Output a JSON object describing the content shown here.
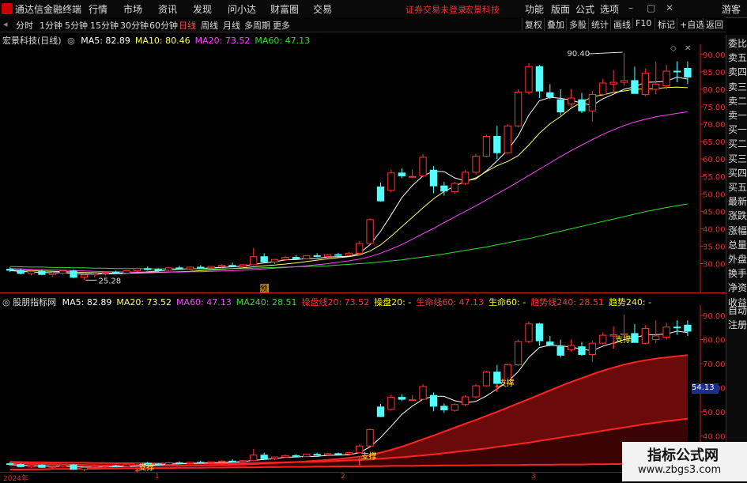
{
  "app": {
    "title": "通达信金融终端"
  },
  "menu": [
    "行情",
    "市场",
    "资讯",
    "发现",
    "问小达",
    "财富圈",
    "交易"
  ],
  "warning": "证券交易未登录",
  "brand": "宏景科技",
  "right_menu": [
    "功能",
    "版面",
    "公式",
    "选项"
  ],
  "window_controls": [
    "–",
    "▢",
    "✕"
  ],
  "guest": "游客",
  "periods": [
    "分时",
    "1分钟",
    "5分钟",
    "15分钟",
    "30分钟",
    "60分钟",
    "日线",
    "周线",
    "月线",
    "多周期",
    "更多"
  ],
  "active_period": "日线",
  "tools": [
    "复权",
    "叠加",
    "多股",
    "统计",
    "画线",
    "F10",
    "标记",
    "+自选",
    "返回"
  ],
  "main_chart": {
    "stock": "宏景科技(日线)",
    "legend": [
      {
        "label": "MA5: 82.89",
        "color": "#ffffff"
      },
      {
        "label": "MA10: 80.46",
        "color": "#ffff66"
      },
      {
        "label": "MA20: 73.52",
        "color": "#ff44ff"
      },
      {
        "label": "MA60: 47.13",
        "color": "#33dd33"
      }
    ],
    "y_ticks": [
      "90.00",
      "85.00",
      "80.00",
      "75.00",
      "70.00",
      "65.00",
      "60.00",
      "55.00",
      "50.00",
      "45.00",
      "40.00",
      "35.00",
      "30.00"
    ],
    "high_marker": "90.40",
    "low_marker": "25.28",
    "badge": "预"
  },
  "sub_chart": {
    "name": "股朋指标网",
    "legend": [
      {
        "label": "MA5: 82.89",
        "color": "#ffffff"
      },
      {
        "label": "MA20: 73.52",
        "color": "#ffff66"
      },
      {
        "label": "MA60: 47.13",
        "color": "#ff44ff"
      },
      {
        "label": "MA240: 28.51",
        "color": "#33dd33"
      },
      {
        "label": "操盘线20: 73.52",
        "color": "#ff3333"
      },
      {
        "label": "操盘20: -",
        "color": "#ffff00"
      },
      {
        "label": "生命线60: 47.13",
        "color": "#ff3333"
      },
      {
        "label": "生命60: -",
        "color": "#ffff00"
      },
      {
        "label": "趋势线240: 28.51",
        "color": "#ff3333"
      },
      {
        "label": "趋势240: -",
        "color": "#ffff00"
      }
    ],
    "y_ticks": [
      "90.00",
      "80.00",
      "70.00",
      "60.00",
      "50.00",
      "40.00"
    ],
    "value_tag": "54.13",
    "support_labels": [
      "支撑",
      "支撑",
      "支撑",
      "支撑"
    ]
  },
  "sidebar_top": [
    "委比",
    "卖五",
    "卖四",
    "卖三",
    "卖二",
    "卖一",
    "买一",
    "买二",
    "买三",
    "买四",
    "买五",
    "最新",
    "涨跌",
    "涨幅",
    "总量",
    "外盘",
    "换手",
    "净资",
    "收益"
  ],
  "sidebar_bottom": [
    "自动",
    "注册"
  ],
  "dates": [
    "2024年",
    "1",
    "2",
    "3"
  ],
  "watermark": {
    "title": "指标公式网",
    "url": "www.zbgs3.com"
  },
  "colors": {
    "up": "#ff3333",
    "down": "#54ffff",
    "axis": "#d33333"
  },
  "chart_data": {
    "type": "candlestick",
    "title": "宏景科技(日线)",
    "ylim": [
      24,
      92
    ],
    "x": [
      0,
      1,
      2,
      3,
      4,
      5,
      6,
      7,
      8,
      9,
      10,
      11,
      12,
      13,
      14,
      15,
      16,
      17,
      18,
      19,
      20,
      21,
      22,
      23,
      24,
      25,
      26,
      27,
      28,
      29,
      30,
      31,
      32,
      33,
      34,
      35,
      36,
      37,
      38,
      39,
      40,
      41,
      42,
      43,
      44,
      45,
      46,
      47,
      48,
      49,
      50,
      51,
      52,
      53,
      54,
      55,
      56,
      57,
      58,
      59,
      60,
      61,
      62,
      63,
      64
    ],
    "ohlc": [
      [
        28.4,
        29.0,
        27.6,
        28.1
      ],
      [
        28.1,
        28.6,
        26.9,
        27.2
      ],
      [
        27.2,
        28.0,
        26.6,
        27.8
      ],
      [
        27.8,
        28.2,
        26.7,
        26.9
      ],
      [
        26.9,
        27.5,
        26.2,
        27.3
      ],
      [
        27.3,
        28.1,
        26.8,
        27.9
      ],
      [
        27.9,
        28.3,
        25.8,
        26.1
      ],
      [
        26.1,
        27.0,
        25.3,
        26.8
      ],
      [
        26.8,
        27.4,
        26.0,
        27.2
      ],
      [
        27.2,
        27.9,
        26.6,
        27.5
      ],
      [
        27.5,
        28.0,
        27.0,
        27.3
      ],
      [
        27.3,
        28.2,
        27.1,
        28.0
      ],
      [
        28.0,
        28.9,
        27.6,
        28.6
      ],
      [
        28.6,
        29.2,
        28.0,
        28.3
      ],
      [
        28.3,
        28.7,
        27.6,
        28.1
      ],
      [
        28.1,
        29.0,
        27.8,
        28.8
      ],
      [
        28.8,
        29.4,
        28.3,
        28.5
      ],
      [
        28.5,
        29.2,
        28.1,
        29.0
      ],
      [
        29.0,
        29.6,
        28.5,
        28.8
      ],
      [
        28.8,
        29.3,
        28.4,
        29.2
      ],
      [
        29.2,
        29.8,
        28.9,
        29.5
      ],
      [
        29.5,
        30.3,
        29.0,
        29.3
      ],
      [
        29.3,
        29.9,
        29.0,
        29.7
      ],
      [
        29.7,
        34.5,
        29.5,
        32.0
      ],
      [
        32.0,
        33.0,
        30.2,
        30.5
      ],
      [
        30.5,
        31.4,
        29.9,
        31.2
      ],
      [
        31.2,
        32.2,
        30.8,
        31.8
      ],
      [
        31.8,
        32.4,
        31.0,
        31.4
      ],
      [
        31.4,
        32.5,
        31.2,
        32.3
      ],
      [
        32.3,
        33.0,
        31.8,
        32.1
      ],
      [
        32.1,
        32.8,
        31.6,
        32.6
      ],
      [
        32.6,
        33.1,
        32.0,
        32.4
      ],
      [
        32.4,
        33.3,
        32.2,
        33.0
      ],
      [
        33.0,
        36.5,
        32.8,
        35.8
      ],
      [
        35.8,
        43.0,
        35.5,
        42.6
      ],
      [
        52.0,
        53.2,
        47.8,
        48.0
      ],
      [
        51.0,
        57.0,
        50.5,
        56.0
      ],
      [
        56.0,
        57.3,
        54.5,
        55.2
      ],
      [
        55.0,
        57.0,
        54.6,
        55.0
      ],
      [
        55.2,
        61.5,
        54.8,
        60.5
      ],
      [
        56.8,
        58.0,
        50.2,
        52.3
      ],
      [
        52.3,
        53.5,
        49.5,
        50.8
      ],
      [
        50.6,
        53.5,
        50.0,
        53.0
      ],
      [
        53.0,
        56.8,
        52.5,
        56.2
      ],
      [
        56.2,
        61.5,
        55.5,
        60.8
      ],
      [
        60.8,
        67.0,
        60.5,
        66.5
      ],
      [
        66.5,
        69.5,
        60.0,
        61.8
      ],
      [
        61.8,
        70.0,
        61.5,
        69.5
      ],
      [
        69.5,
        80.0,
        69.0,
        79.2
      ],
      [
        79.2,
        87.5,
        78.5,
        86.5
      ],
      [
        86.5,
        87.0,
        77.5,
        79.5
      ],
      [
        79.0,
        81.5,
        77.2,
        77.8
      ],
      [
        77.0,
        80.0,
        72.5,
        73.5
      ],
      [
        75.8,
        80.0,
        75.0,
        77.5
      ],
      [
        77.0,
        79.0,
        73.2,
        73.8
      ],
      [
        73.8,
        79.5,
        70.8,
        78.5
      ],
      [
        78.5,
        83.0,
        78.0,
        81.8
      ],
      [
        81.5,
        85.5,
        79.0,
        82.0
      ],
      [
        82.0,
        90.4,
        81.0,
        82.5
      ],
      [
        82.5,
        86.5,
        79.0,
        78.8
      ],
      [
        78.5,
        86.0,
        78.0,
        84.6
      ],
      [
        80.0,
        88.0,
        78.5,
        81.5
      ],
      [
        81.0,
        87.0,
        80.0,
        85.2
      ],
      [
        85.2,
        88.0,
        82.0,
        85.0
      ],
      [
        86.0,
        88.0,
        81.5,
        83.5
      ]
    ],
    "series": [
      {
        "name": "MA5",
        "values": [
          28.0,
          27.8,
          27.6,
          27.5,
          27.4,
          27.4,
          27.2,
          27.0,
          27.0,
          27.1,
          27.1,
          27.2,
          27.4,
          27.7,
          27.9,
          28.2,
          28.4,
          28.5,
          28.6,
          28.8,
          28.9,
          29.1,
          29.3,
          29.8,
          30.2,
          30.5,
          31.1,
          31.2,
          31.4,
          31.5,
          31.9,
          32.0,
          32.1,
          33.0,
          35.4,
          39.3,
          44.0,
          48.9,
          52.4,
          55.2,
          56.5,
          56.4,
          54.6,
          53.7,
          54.3,
          56.6,
          59.5,
          62.5,
          66.7,
          72.6,
          76.7,
          77.7,
          77.4,
          76.9,
          76.0,
          75.4,
          77.3,
          78.6,
          80.0,
          80.7,
          82.0,
          82.1,
          82.3,
          83.5,
          82.9
        ]
      },
      {
        "name": "MA10",
        "values": [
          28.2,
          28.1,
          28.0,
          27.9,
          27.8,
          27.7,
          27.6,
          27.5,
          27.4,
          27.3,
          27.3,
          27.3,
          27.3,
          27.4,
          27.5,
          27.6,
          27.7,
          27.8,
          28.0,
          28.2,
          28.4,
          28.6,
          28.8,
          29.1,
          29.4,
          29.6,
          29.9,
          30.2,
          30.6,
          31.0,
          31.4,
          31.7,
          32.0,
          32.5,
          33.6,
          35.4,
          37.9,
          40.6,
          43.3,
          46.0,
          48.6,
          50.7,
          52.2,
          53.6,
          54.6,
          56.4,
          58.1,
          59.3,
          61.0,
          64.0,
          67.4,
          70.1,
          72.2,
          74.6,
          76.3,
          77.9,
          78.4,
          79.1,
          79.5,
          80.0,
          80.1,
          80.2,
          80.5,
          80.6,
          80.46
        ]
      },
      {
        "name": "MA20",
        "values": [
          28.6,
          28.5,
          28.4,
          28.3,
          28.2,
          28.1,
          28.0,
          27.9,
          27.8,
          27.7,
          27.7,
          27.6,
          27.6,
          27.6,
          27.6,
          27.6,
          27.6,
          27.7,
          27.7,
          27.8,
          27.9,
          28.0,
          28.1,
          28.3,
          28.5,
          28.7,
          28.9,
          29.1,
          29.4,
          29.7,
          30.0,
          30.4,
          30.8,
          31.3,
          32.0,
          33.0,
          34.2,
          35.5,
          37.0,
          38.6,
          40.1,
          41.8,
          43.4,
          45.0,
          46.6,
          48.3,
          50.0,
          51.7,
          53.5,
          55.3,
          57.1,
          58.9,
          60.7,
          62.4,
          64.0,
          65.6,
          67.1,
          68.4,
          69.6,
          70.6,
          71.4,
          72.1,
          72.6,
          73.1,
          73.52
        ]
      },
      {
        "name": "MA60",
        "values": [
          29.2,
          29.1,
          29.0,
          29.0,
          28.9,
          28.9,
          28.8,
          28.8,
          28.7,
          28.7,
          28.6,
          28.6,
          28.6,
          28.5,
          28.5,
          28.5,
          28.5,
          28.5,
          28.5,
          28.5,
          28.5,
          28.6,
          28.6,
          28.7,
          28.8,
          28.9,
          29.0,
          29.1,
          29.2,
          29.3,
          29.4,
          29.6,
          29.8,
          30.0,
          30.2,
          30.5,
          30.8,
          31.1,
          31.5,
          31.9,
          32.3,
          32.8,
          33.3,
          33.8,
          34.3,
          34.8,
          35.4,
          36.0,
          36.6,
          37.2,
          37.9,
          38.6,
          39.3,
          40.0,
          40.7,
          41.4,
          42.1,
          42.8,
          43.5,
          44.2,
          44.9,
          45.5,
          46.1,
          46.6,
          47.13
        ]
      },
      {
        "name": "MA240",
        "values": [
          26.0,
          26.0,
          26.1,
          26.1,
          26.2,
          26.2,
          26.2,
          26.3,
          26.3,
          26.4,
          26.4,
          26.5,
          26.5,
          26.5,
          26.6,
          26.6,
          26.7,
          26.7,
          26.7,
          26.8,
          26.8,
          26.9,
          26.9,
          26.9,
          27.0,
          27.0,
          27.1,
          27.1,
          27.1,
          27.2,
          27.2,
          27.3,
          27.3,
          27.3,
          27.4,
          27.4,
          27.5,
          27.5,
          27.5,
          27.6,
          27.6,
          27.7,
          27.7,
          27.7,
          27.8,
          27.8,
          27.9,
          27.9,
          27.9,
          28.0,
          28.0,
          28.0,
          28.1,
          28.1,
          28.1,
          28.2,
          28.2,
          28.3,
          28.3,
          28.3,
          28.4,
          28.4,
          28.4,
          28.5,
          28.51
        ]
      }
    ]
  }
}
